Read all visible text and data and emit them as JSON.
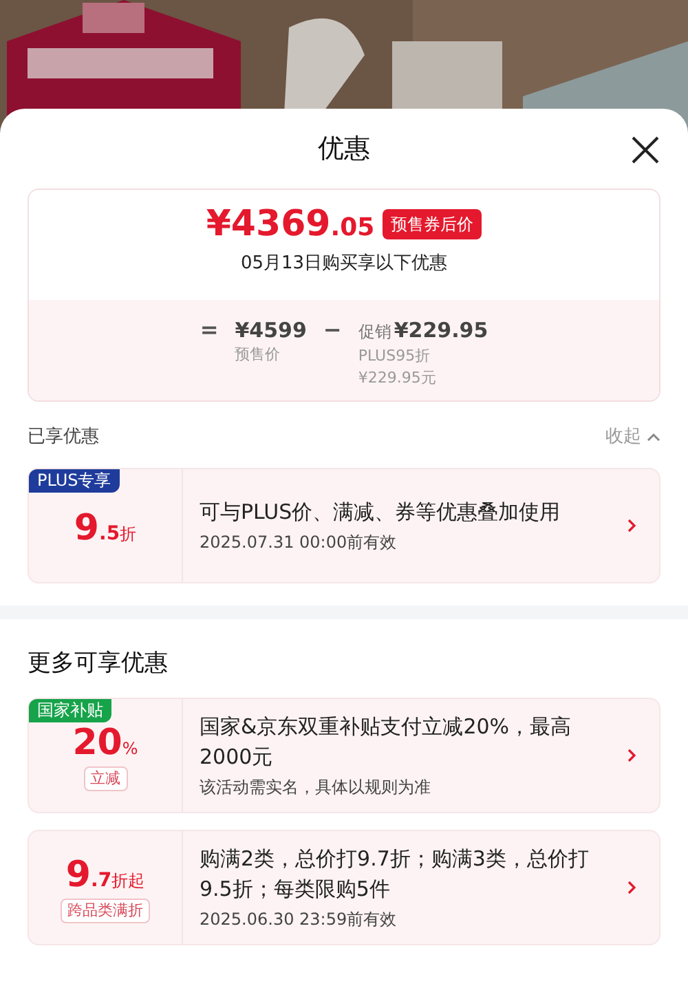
{
  "header": {
    "title": "优惠"
  },
  "summary": {
    "price_integer": "¥4369",
    "price_decimal": ".05",
    "price_badge": "预售券后价",
    "subtitle": "05月13日购买享以下优惠",
    "equals": "=",
    "base_price": "¥4599",
    "base_label": "预售价",
    "minus": "−",
    "promo_label": "促销",
    "promo_amount": "¥229.95",
    "promo_detail": "PLUS95折",
    "promo_detail_amount": "¥229.95元"
  },
  "applied_section": {
    "title": "已享优惠",
    "toggle": "收起",
    "expanded": true,
    "coupons": [
      {
        "tag": "PLUS专享",
        "color": "#1f3c9c",
        "value_main": "9",
        "value_minor": ".5",
        "unit": "折",
        "description": "可与PLUS价、满减、券等优惠叠加使用",
        "validity": "2025.07.31 00:00前有效"
      }
    ]
  },
  "more_section": {
    "title": "更多可享优惠",
    "coupons": [
      {
        "tag": "国家补贴",
        "color": "#16a34a",
        "value_main": "20",
        "unit": "%",
        "sub_label": "立减",
        "description": "国家&京东双重补贴支付立减20%，最高2000元",
        "validity": "该活动需实名，具体以规则为准"
      },
      {
        "value_main": "9",
        "value_minor": ".7",
        "unit": "折起",
        "sub_label": "跨品类满折",
        "description": "购满2类，总价打9.7折；购满3类，总价打9.5折；每类限购5件",
        "validity": "2025.06.30 23:59前有效"
      }
    ]
  }
}
